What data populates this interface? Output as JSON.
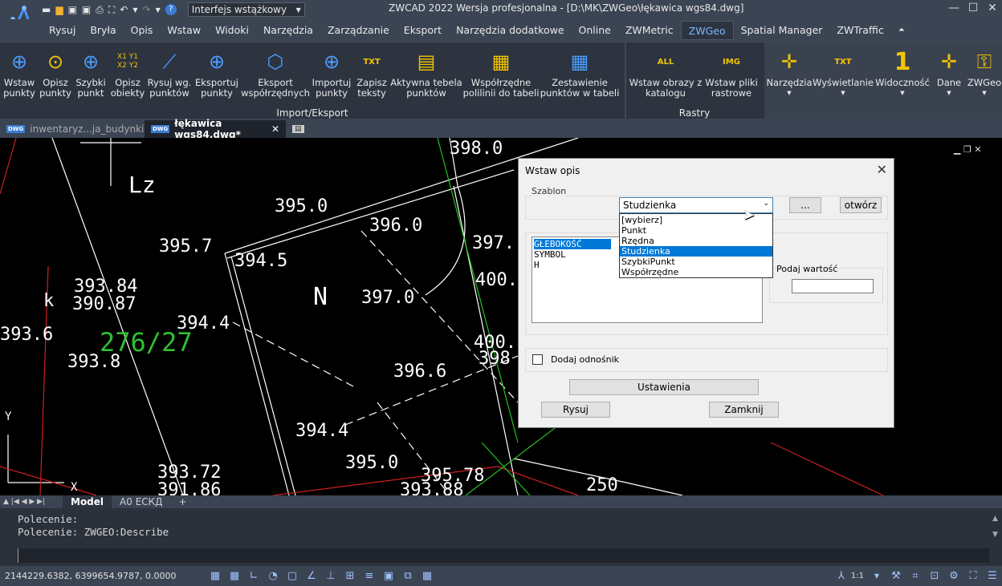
{
  "app": {
    "title": "ZWCAD 2022 Wersja profesjonalna - [D:\\MK\\ZWGeo\\łękawica wgs84.dwg]",
    "workspace": "Interfejs wstążkowy"
  },
  "menu": [
    "Rysuj",
    "Bryła",
    "Opis",
    "Wstaw",
    "Widoki",
    "Narzędzia",
    "Zarządzanie",
    "Eksport",
    "Narzędzia dodatkowe",
    "Online",
    "ZWMetric",
    "ZWGeo",
    "Spatial Manager",
    "ZWTraffic"
  ],
  "menu_active": "ZWGeo",
  "ribbon": {
    "import_group": "Import/Eksport",
    "raster_group": "Rastry",
    "buttons": {
      "wstaw_punkty": "Wstaw\npunkty",
      "opisz_punkty": "Opisz\npunkty",
      "szybki_punkt": "Szybki\npunkt",
      "opisz_obiekty": "Opisz\nobiekty",
      "rysuj_wg": "Rysuj wg.\npunktów",
      "eksportuj": "Eksportuj\npunkty",
      "eksport_wsp": "Eksport\nwspółrzędnych",
      "importuj": "Importuj\npunkty",
      "zapisz": "Zapisz\nteksty",
      "aktywna": "Aktywna tebela\npunktów",
      "wspolrzedne": "Współrzędne\npolilinii do tabeli",
      "zestawienie": "Zestawienie\npunktów w tabeli",
      "wstaw_obrazy": "Wstaw obrazy z\nkatalogu",
      "wstaw_pliki": "Wstaw pliki\nrastrowe",
      "narzedzia": "Narzędzia",
      "wyswietlanie": "Wyświetlanie",
      "widocznosc": "Widoczność",
      "dane": "Dane",
      "zwgeo": "ZWGeo"
    },
    "icon_text": {
      "x1y1": "X1 Y1",
      "x2y2": "X2 Y2",
      "txt": "TXT",
      "all": "ALL",
      "img": "IMG"
    }
  },
  "doc_tabs": [
    {
      "label": "inwentaryz...ja_budynki.dwg",
      "active": false
    },
    {
      "label": "łękawica wgs84.dwg*",
      "active": true
    }
  ],
  "drawing_labels": [
    "398.0",
    "Lz",
    "395.0",
    "396.0",
    "397.",
    "395.7",
    "394.5",
    "393.84",
    "390.87",
    "N",
    "397.0",
    "400.",
    "393.6",
    "394.4",
    "276/27",
    "400.",
    "393.8",
    "398",
    "396.6",
    "394.4",
    "395.0",
    "395.78",
    "393.72",
    "391.86",
    "393.88",
    "250",
    "k",
    "Y",
    "X"
  ],
  "model_tabs": [
    "Model",
    "A0 ЕСКД",
    "+"
  ],
  "command": {
    "lines": [
      "Polecenie:",
      "Polecenie: ZWGEO:Describe"
    ]
  },
  "status": {
    "coords": "2144229.6382, 6399654.9787, 0.0000",
    "scale": "1:1"
  },
  "dialog": {
    "title": "Wstaw opis",
    "szablon_label": "Szablon",
    "combo_value": "Studzienka",
    "options": [
      "[wybierz]",
      "Punkt",
      "Rzędna",
      "Studzienka",
      "SzybkiPunkt",
      "Współrzędne"
    ],
    "selected_option": "Studzienka",
    "dots_button": "...",
    "open_button": "otwórz",
    "list_items": [
      "GŁEBOKOŚĆ",
      "SYMBOL",
      "H"
    ],
    "value_label": "Podaj wartość",
    "value": "",
    "add_ref": "Dodaj odnośnik",
    "settings_button": "Ustawienia",
    "draw_button": "Rysuj",
    "close_button": "Zamknij"
  }
}
